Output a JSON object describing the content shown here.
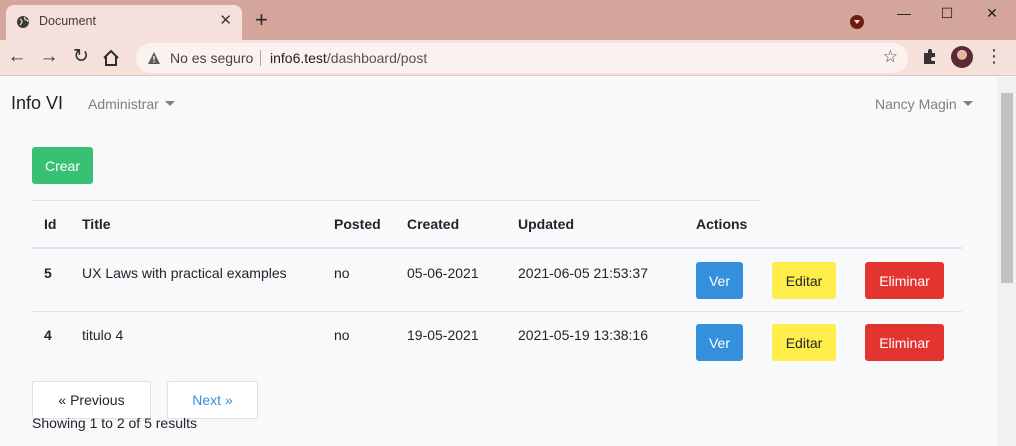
{
  "browser": {
    "tab_title": "Document",
    "tab_close": "✕",
    "new_tab": "+",
    "security_label": "No es seguro",
    "url_host": "info6.test",
    "url_path": "/dashboard/post",
    "window_controls": {
      "minimize": "—",
      "maximize": "☐",
      "close": "✕"
    }
  },
  "navbar": {
    "brand": "Info VI",
    "admin_menu": "Administrar",
    "user_menu": "Nancy Magin"
  },
  "actions": {
    "create_label": "Crear"
  },
  "table": {
    "headers": [
      "Id",
      "Title",
      "Posted",
      "Created",
      "Updated",
      "Actions"
    ],
    "rows": [
      {
        "id": "5",
        "title": "UX Laws with practical examples",
        "posted": "no",
        "created": "05-06-2021",
        "updated": "2021-06-05 21:53:37"
      },
      {
        "id": "4",
        "title": "titulo 4",
        "posted": "no",
        "created": "19-05-2021",
        "updated": "2021-05-19 13:38:16"
      }
    ],
    "row_actions": {
      "view": "Ver",
      "edit": "Editar",
      "delete": "Eliminar"
    }
  },
  "pagination": {
    "previous": "« Previous",
    "next": "Next »",
    "summary": "Showing 1 to 2 of 5 results"
  },
  "colors": {
    "create": "#38c172",
    "view": "#3490dc",
    "edit": "#ffed4a",
    "delete": "#e3342f",
    "link": "#3490dc"
  }
}
